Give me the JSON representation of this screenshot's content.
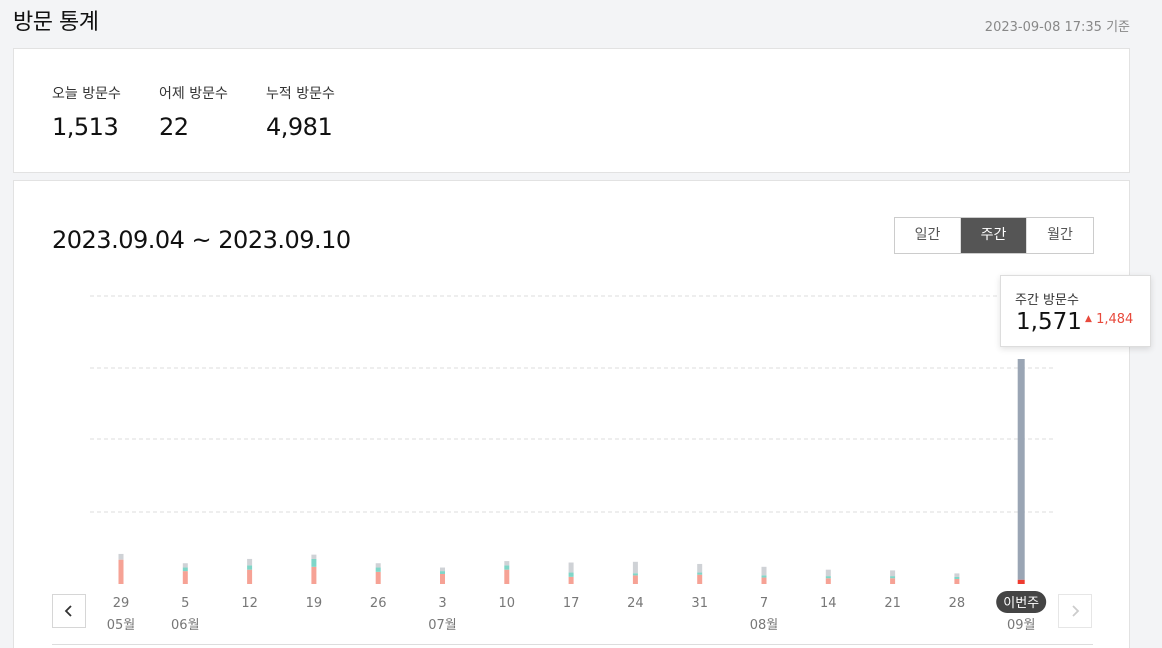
{
  "header": {
    "title": "방문 통계",
    "timestamp": "2023-09-08 17:35 기준"
  },
  "summary": {
    "today": {
      "label": "오늘 방문수",
      "value": "1,513"
    },
    "yesterday": {
      "label": "어제 방문수",
      "value": "22"
    },
    "total": {
      "label": "누적 방문수",
      "value": "4,981"
    }
  },
  "chart_header": {
    "date_range": "2023.09.04 ~ 2023.09.10",
    "tabs": [
      {
        "label": "일간",
        "active": false
      },
      {
        "label": "주간",
        "active": true
      },
      {
        "label": "월간",
        "active": false
      }
    ]
  },
  "tooltip": {
    "label": "주간 방문수",
    "value": "1,571",
    "delta_icon": "triangle-up-icon",
    "delta": "1,484"
  },
  "navigation": {
    "prev_icon": "chevron-left-icon",
    "next_icon": "chevron-right-icon"
  },
  "colors": {
    "bar_primary": "#f6a295",
    "bar_secondary": "#7fd6c8",
    "bar_tertiary": "#cfd2d6",
    "current_week_bar": "#9aa5b4",
    "current_week_accent": "#ee3b2f",
    "delta_red": "#e84a3c",
    "active_tab": "#555555"
  },
  "chart_data": {
    "type": "bar",
    "x_labels": [
      "29",
      "5",
      "12",
      "19",
      "26",
      "3",
      "10",
      "17",
      "24",
      "31",
      "7",
      "14",
      "21",
      "28",
      "이번주"
    ],
    "month_labels": [
      "05월",
      "06월",
      "",
      "",
      "",
      "07월",
      "",
      "",
      "",
      "",
      "08월",
      "",
      "",
      "",
      "09월"
    ],
    "highlighted": "이번주",
    "ylim": [
      0,
      1571
    ],
    "grid": true,
    "stacks": [
      [
        {
          "v": 170,
          "c": "#f6a295"
        },
        {
          "v": 40,
          "c": "#cfd2d6"
        }
      ],
      [
        {
          "v": 90,
          "c": "#f6a295"
        },
        {
          "v": 25,
          "c": "#7fd6c8"
        },
        {
          "v": 30,
          "c": "#cfd2d6"
        }
      ],
      [
        {
          "v": 100,
          "c": "#f6a295"
        },
        {
          "v": 30,
          "c": "#7fd6c8"
        },
        {
          "v": 45,
          "c": "#cfd2d6"
        }
      ],
      [
        {
          "v": 120,
          "c": "#f6a295"
        },
        {
          "v": 55,
          "c": "#7fd6c8"
        },
        {
          "v": 30,
          "c": "#cfd2d6"
        }
      ],
      [
        {
          "v": 85,
          "c": "#f6a295"
        },
        {
          "v": 30,
          "c": "#7fd6c8"
        },
        {
          "v": 30,
          "c": "#cfd2d6"
        }
      ],
      [
        {
          "v": 70,
          "c": "#f6a295"
        },
        {
          "v": 20,
          "c": "#7fd6c8"
        },
        {
          "v": 25,
          "c": "#cfd2d6"
        }
      ],
      [
        {
          "v": 100,
          "c": "#f6a295"
        },
        {
          "v": 30,
          "c": "#7fd6c8"
        },
        {
          "v": 30,
          "c": "#cfd2d6"
        }
      ],
      [
        {
          "v": 50,
          "c": "#f6a295"
        },
        {
          "v": 30,
          "c": "#7fd6c8"
        },
        {
          "v": 70,
          "c": "#cfd2d6"
        }
      ],
      [
        {
          "v": 60,
          "c": "#f6a295"
        },
        {
          "v": 15,
          "c": "#7fd6c8"
        },
        {
          "v": 80,
          "c": "#cfd2d6"
        }
      ],
      [
        {
          "v": 65,
          "c": "#f6a295"
        },
        {
          "v": 15,
          "c": "#7fd6c8"
        },
        {
          "v": 60,
          "c": "#cfd2d6"
        }
      ],
      [
        {
          "v": 45,
          "c": "#f6a295"
        },
        {
          "v": 15,
          "c": "#7fd6c8"
        },
        {
          "v": 60,
          "c": "#cfd2d6"
        }
      ],
      [
        {
          "v": 40,
          "c": "#f6a295"
        },
        {
          "v": 15,
          "c": "#7fd6c8"
        },
        {
          "v": 45,
          "c": "#cfd2d6"
        }
      ],
      [
        {
          "v": 40,
          "c": "#f6a295"
        },
        {
          "v": 15,
          "c": "#7fd6c8"
        },
        {
          "v": 40,
          "c": "#cfd2d6"
        }
      ],
      [
        {
          "v": 35,
          "c": "#f6a295"
        },
        {
          "v": 10,
          "c": "#7fd6c8"
        },
        {
          "v": 25,
          "c": "#cfd2d6"
        }
      ],
      [
        {
          "v": 30,
          "c": "#ee3b2f"
        },
        {
          "v": 1541,
          "c": "#9aa5b4"
        }
      ]
    ]
  }
}
